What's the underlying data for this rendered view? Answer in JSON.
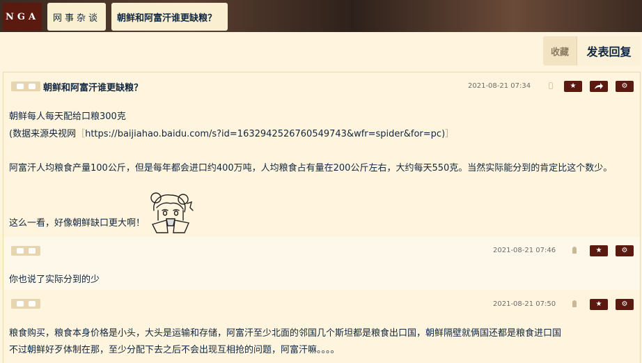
{
  "nav": {
    "logo": "NGA",
    "forum": "网事杂谈",
    "topic": "朝鲜和阿富汗谁更缺粮？"
  },
  "actions": {
    "favorite": "收藏",
    "reply": "发表回复"
  },
  "posts": [
    {
      "title": "朝鲜和阿富汗谁更缺粮？",
      "date": "2021-08-21 07:34",
      "device_icon": "phone-icon",
      "buttons": [
        "star-icon",
        "share-icon",
        "gear-icon"
      ],
      "lines": [
        "朝鲜每人每天配给口粮300克",
        "(数据来源央视网",
        "https://baijiahao.baidu.com/s?id=1632942526760549743&wfr=spider&for=pc)",
        "阿富汗人均粮食产量100公斤，但是每年都会进口约400万吨，人均粮食占有量在200公斤左右，大约每天550克。当然实际能分到的肯定比这个数少。",
        "这么一看，好像朝鲜缺口更大啊！"
      ],
      "sticker": "anime-girl-sticker"
    },
    {
      "date": "2021-08-21 07:46",
      "device_icon": "android-icon",
      "buttons": [
        "star-icon",
        "gear-icon"
      ],
      "lines": [
        "你也说了实际分到的少"
      ]
    },
    {
      "date": "2021-08-21 07:50",
      "device_icon": "android-icon",
      "buttons": [
        "star-icon",
        "gear-icon"
      ],
      "lines": [
        "粮食购买，粮食本身价格是小头，大头是运输和存储，阿富汗至少北面的邻国几个斯坦都是粮食出口国，朝鲜隔壁就俩国还都是粮食进口国",
        "不过朝鲜好歹体制在那，至少分配下去之后不会出现互相抢的问题，阿富汗嘛。。。。"
      ]
    }
  ],
  "colors": {
    "accent": "#5b1a10",
    "background": "#fff4dd",
    "text": "#10273f"
  }
}
